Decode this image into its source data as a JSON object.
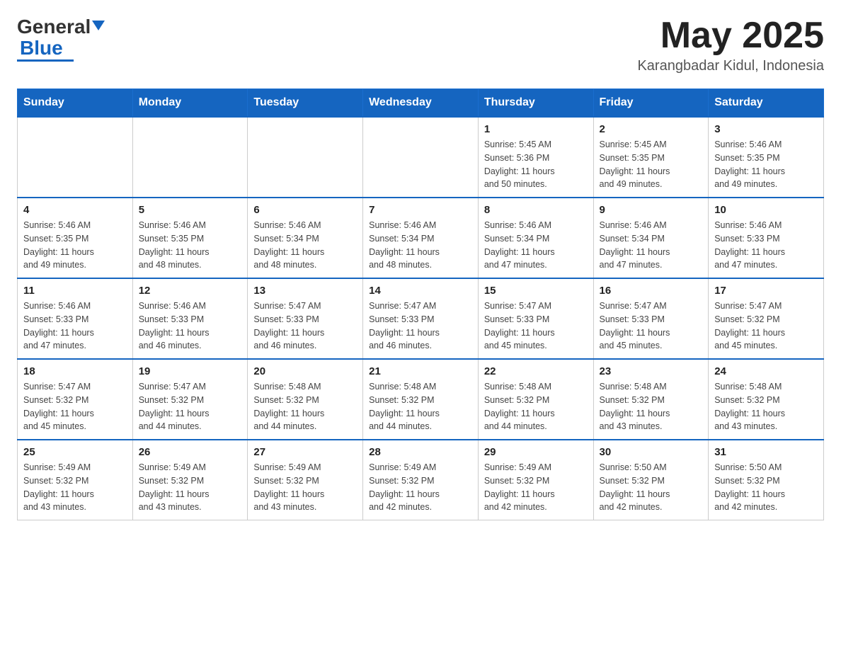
{
  "header": {
    "logo_general": "General",
    "logo_blue": "Blue",
    "month_year": "May 2025",
    "location": "Karangbadar Kidul, Indonesia"
  },
  "days_of_week": [
    "Sunday",
    "Monday",
    "Tuesday",
    "Wednesday",
    "Thursday",
    "Friday",
    "Saturday"
  ],
  "weeks": [
    [
      {
        "day": "",
        "info": ""
      },
      {
        "day": "",
        "info": ""
      },
      {
        "day": "",
        "info": ""
      },
      {
        "day": "",
        "info": ""
      },
      {
        "day": "1",
        "info": "Sunrise: 5:45 AM\nSunset: 5:36 PM\nDaylight: 11 hours\nand 50 minutes."
      },
      {
        "day": "2",
        "info": "Sunrise: 5:45 AM\nSunset: 5:35 PM\nDaylight: 11 hours\nand 49 minutes."
      },
      {
        "day": "3",
        "info": "Sunrise: 5:46 AM\nSunset: 5:35 PM\nDaylight: 11 hours\nand 49 minutes."
      }
    ],
    [
      {
        "day": "4",
        "info": "Sunrise: 5:46 AM\nSunset: 5:35 PM\nDaylight: 11 hours\nand 49 minutes."
      },
      {
        "day": "5",
        "info": "Sunrise: 5:46 AM\nSunset: 5:35 PM\nDaylight: 11 hours\nand 48 minutes."
      },
      {
        "day": "6",
        "info": "Sunrise: 5:46 AM\nSunset: 5:34 PM\nDaylight: 11 hours\nand 48 minutes."
      },
      {
        "day": "7",
        "info": "Sunrise: 5:46 AM\nSunset: 5:34 PM\nDaylight: 11 hours\nand 48 minutes."
      },
      {
        "day": "8",
        "info": "Sunrise: 5:46 AM\nSunset: 5:34 PM\nDaylight: 11 hours\nand 47 minutes."
      },
      {
        "day": "9",
        "info": "Sunrise: 5:46 AM\nSunset: 5:34 PM\nDaylight: 11 hours\nand 47 minutes."
      },
      {
        "day": "10",
        "info": "Sunrise: 5:46 AM\nSunset: 5:33 PM\nDaylight: 11 hours\nand 47 minutes."
      }
    ],
    [
      {
        "day": "11",
        "info": "Sunrise: 5:46 AM\nSunset: 5:33 PM\nDaylight: 11 hours\nand 47 minutes."
      },
      {
        "day": "12",
        "info": "Sunrise: 5:46 AM\nSunset: 5:33 PM\nDaylight: 11 hours\nand 46 minutes."
      },
      {
        "day": "13",
        "info": "Sunrise: 5:47 AM\nSunset: 5:33 PM\nDaylight: 11 hours\nand 46 minutes."
      },
      {
        "day": "14",
        "info": "Sunrise: 5:47 AM\nSunset: 5:33 PM\nDaylight: 11 hours\nand 46 minutes."
      },
      {
        "day": "15",
        "info": "Sunrise: 5:47 AM\nSunset: 5:33 PM\nDaylight: 11 hours\nand 45 minutes."
      },
      {
        "day": "16",
        "info": "Sunrise: 5:47 AM\nSunset: 5:33 PM\nDaylight: 11 hours\nand 45 minutes."
      },
      {
        "day": "17",
        "info": "Sunrise: 5:47 AM\nSunset: 5:32 PM\nDaylight: 11 hours\nand 45 minutes."
      }
    ],
    [
      {
        "day": "18",
        "info": "Sunrise: 5:47 AM\nSunset: 5:32 PM\nDaylight: 11 hours\nand 45 minutes."
      },
      {
        "day": "19",
        "info": "Sunrise: 5:47 AM\nSunset: 5:32 PM\nDaylight: 11 hours\nand 44 minutes."
      },
      {
        "day": "20",
        "info": "Sunrise: 5:48 AM\nSunset: 5:32 PM\nDaylight: 11 hours\nand 44 minutes."
      },
      {
        "day": "21",
        "info": "Sunrise: 5:48 AM\nSunset: 5:32 PM\nDaylight: 11 hours\nand 44 minutes."
      },
      {
        "day": "22",
        "info": "Sunrise: 5:48 AM\nSunset: 5:32 PM\nDaylight: 11 hours\nand 44 minutes."
      },
      {
        "day": "23",
        "info": "Sunrise: 5:48 AM\nSunset: 5:32 PM\nDaylight: 11 hours\nand 43 minutes."
      },
      {
        "day": "24",
        "info": "Sunrise: 5:48 AM\nSunset: 5:32 PM\nDaylight: 11 hours\nand 43 minutes."
      }
    ],
    [
      {
        "day": "25",
        "info": "Sunrise: 5:49 AM\nSunset: 5:32 PM\nDaylight: 11 hours\nand 43 minutes."
      },
      {
        "day": "26",
        "info": "Sunrise: 5:49 AM\nSunset: 5:32 PM\nDaylight: 11 hours\nand 43 minutes."
      },
      {
        "day": "27",
        "info": "Sunrise: 5:49 AM\nSunset: 5:32 PM\nDaylight: 11 hours\nand 43 minutes."
      },
      {
        "day": "28",
        "info": "Sunrise: 5:49 AM\nSunset: 5:32 PM\nDaylight: 11 hours\nand 42 minutes."
      },
      {
        "day": "29",
        "info": "Sunrise: 5:49 AM\nSunset: 5:32 PM\nDaylight: 11 hours\nand 42 minutes."
      },
      {
        "day": "30",
        "info": "Sunrise: 5:50 AM\nSunset: 5:32 PM\nDaylight: 11 hours\nand 42 minutes."
      },
      {
        "day": "31",
        "info": "Sunrise: 5:50 AM\nSunset: 5:32 PM\nDaylight: 11 hours\nand 42 minutes."
      }
    ]
  ]
}
